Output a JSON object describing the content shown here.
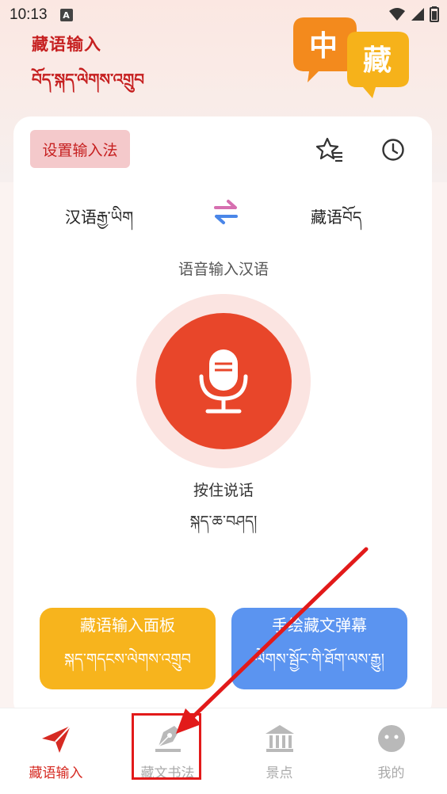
{
  "status_bar": {
    "time": "10:13",
    "notification_letter": "A"
  },
  "app": {
    "title_cn": "藏语输入",
    "title_tb": "བོད་སྐད་ལེགས་འགྲུབ",
    "logo_left": "中",
    "logo_right": "藏"
  },
  "toolbar": {
    "set_ime_label": "设置输入法",
    "favorites_icon": "star-list-icon",
    "history_icon": "clock-icon"
  },
  "languages": {
    "source": "汉语རྒྱ་ཡིག",
    "target": "藏语བོད",
    "swap_icon": "swap-arrows-icon"
  },
  "voice": {
    "hint": "语音输入汉语",
    "hold_cn": "按住说话",
    "hold_tb": "སྐད་ཆ་བཤད།",
    "mic_icon": "microphone-icon"
  },
  "actions": {
    "panel": {
      "line1": "藏语输入面板",
      "line2": "སྐད་གདངས་ལེགས་འགྲུབ"
    },
    "danmu": {
      "line1": "手绘藏文弹幕",
      "line2": "ལེགས་སྦྱོང་གི་ཐོག་ལས་རྒྱུ།"
    }
  },
  "bottom_nav": [
    {
      "label": "藏语输入",
      "icon": "paper-plane-icon",
      "active": true
    },
    {
      "label": "藏文书法",
      "icon": "fountain-pen-icon",
      "active": false
    },
    {
      "label": "景点",
      "icon": "museum-icon",
      "active": false
    },
    {
      "label": "我的",
      "icon": "smiley-icon",
      "active": false
    }
  ],
  "colors": {
    "brand_red": "#c62020",
    "mic_red": "#e8462a",
    "panel_yellow": "#f7b41d",
    "danmu_blue": "#5b94f0",
    "annotation_red": "#e21a1a"
  }
}
